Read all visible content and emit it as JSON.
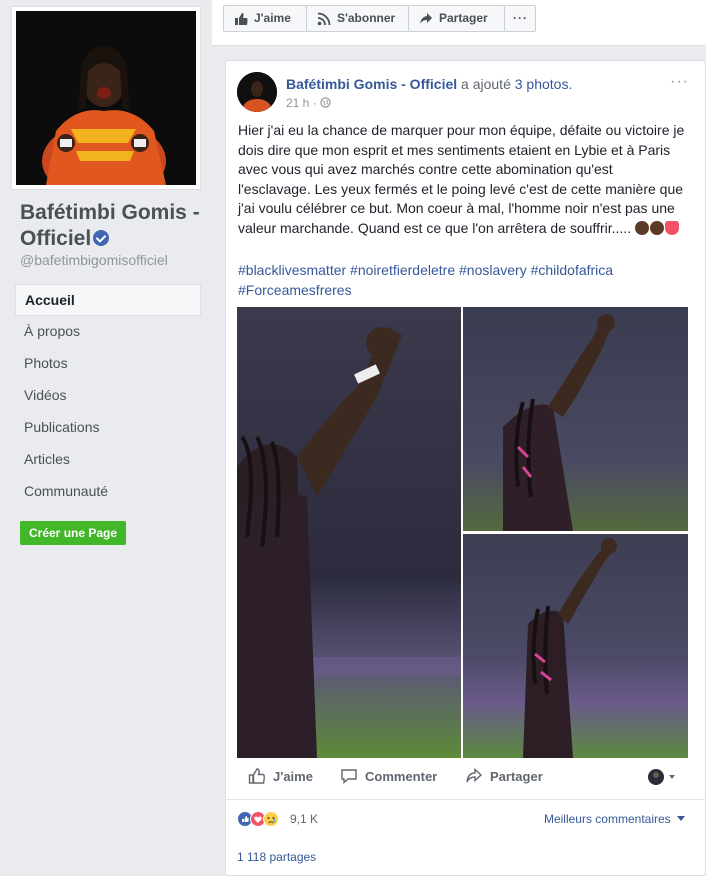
{
  "sidebar": {
    "page_name": "Bafétimbi Gomis - Officiel",
    "handle": "@bafetimbigomisofficiel",
    "nav": [
      {
        "label": "Accueil",
        "active": true
      },
      {
        "label": "À propos"
      },
      {
        "label": "Photos"
      },
      {
        "label": "Vidéos"
      },
      {
        "label": "Publications"
      },
      {
        "label": "Articles"
      },
      {
        "label": "Communauté"
      }
    ],
    "create_page": "Créer une Page"
  },
  "topbar": {
    "like": "J'aime",
    "subscribe": "S'abonner",
    "share": "Partager",
    "more": "···"
  },
  "post": {
    "author": "Bafétimbi Gomis - Officiel",
    "added": "a ajouté",
    "photos_link": "3 photos.",
    "time": "21 h",
    "menu": "···",
    "text": "Hier j'ai eu la chance de marquer pour mon équipe, défaite ou victoire je dois dire que mon esprit et mes sentiments etaient en Lybie et à Paris avec vous qui avez marchés contre cette abomination qu'est l'esclavage. Les yeux fermés et le poing levé c'est de cette manière que j'ai voulu célébrer ce but. Mon coeur à mal, l'homme noir n'est pas une valeur marchande. Quand est ce que l'on arrêtera de souffrir.....",
    "hashtags": "#blacklivesmatter #noiretfierdeletre #noslavery #childofafrica #Forceamesfreres",
    "actions": {
      "like": "J'aime",
      "comment": "Commenter",
      "share": "Partager"
    },
    "reaction_count": "9,1 K",
    "best_comments": "Meilleurs commentaires",
    "shares": "1 118 partages"
  },
  "colors": {
    "link": "#365899",
    "green": "#42b72a",
    "like_blue": "#4267b2"
  }
}
